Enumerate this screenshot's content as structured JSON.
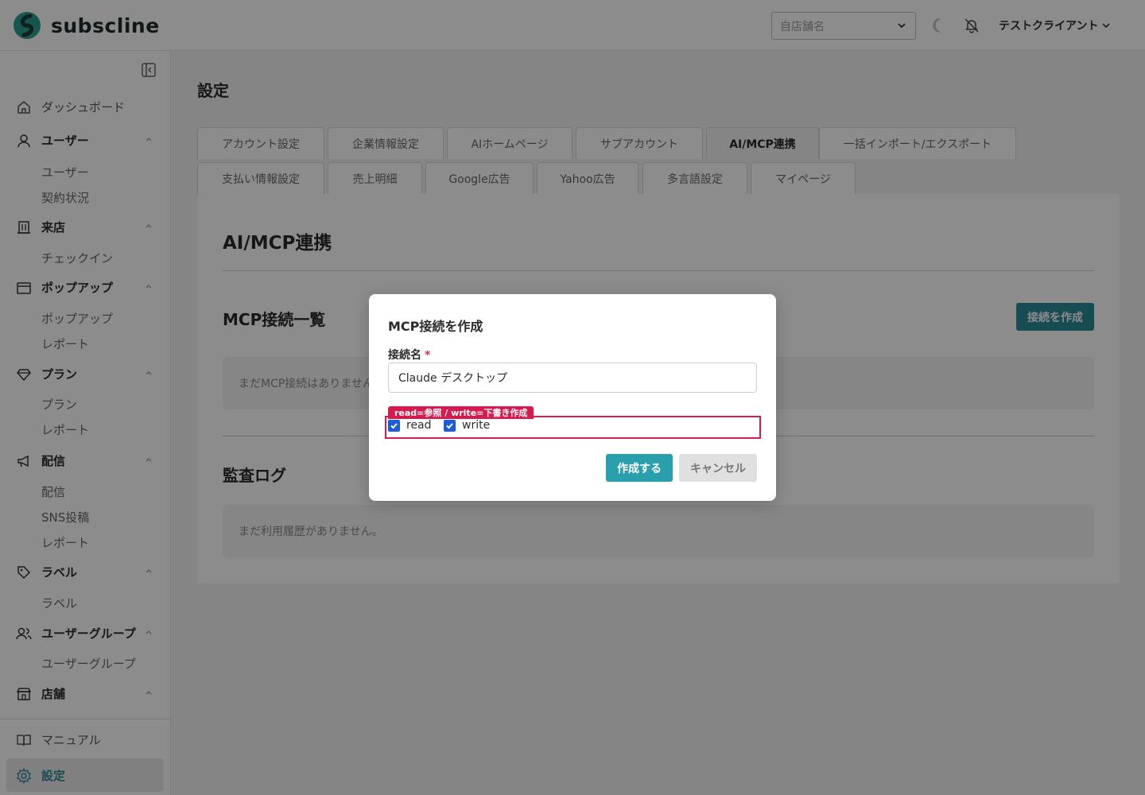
{
  "header": {
    "logo_text": "subscline",
    "store_select_placeholder": "自店舗名",
    "user_name": "テストクライアント"
  },
  "sidebar": {
    "items": {
      "dashboard": "ダッシュボード",
      "users": "ユーザー",
      "users_sub": [
        "ユーザー",
        "契約状況"
      ],
      "visit": "来店",
      "visit_sub": [
        "チェックイン"
      ],
      "popup": "ポップアップ",
      "popup_sub": [
        "ポップアップ",
        "レポート"
      ],
      "plan": "プラン",
      "plan_sub": [
        "プラン",
        "レポート"
      ],
      "delivery": "配信",
      "delivery_sub": [
        "配信",
        "SNS投稿",
        "レポート"
      ],
      "label": "ラベル",
      "label_sub": [
        "ラベル"
      ],
      "usergroup": "ユーザーグループ",
      "usergroup_sub": [
        "ユーザーグループ"
      ],
      "store": "店舗",
      "manual": "マニュアル",
      "settings": "設定"
    }
  },
  "main": {
    "page_title": "設定",
    "tabs_row1": [
      "アカウント設定",
      "企業情報設定",
      "AIホームページ",
      "サブアカウント",
      "AI/MCP連携",
      "一括インポート/エクスポート"
    ],
    "tabs_row2": [
      "支払い情報設定",
      "売上明細",
      "Google広告",
      "Yahoo広告",
      "多言語設定",
      "マイページ"
    ],
    "active_tab": "AI/MCP連携",
    "panel_title": "AI/MCP連携",
    "mcp_section_title": "MCP接続一覧",
    "create_connection_label": "接続を作成",
    "mcp_empty": "まだMCP接続はありません。",
    "audit_section_title": "監査ログ",
    "audit_empty": "まだ利用履歴がありません。"
  },
  "modal": {
    "title": "MCP接続を作成",
    "name_label": "接続名",
    "required_mark": "*",
    "name_value": "Claude デスクトップ",
    "scope_hint": "read=参照 / write=下書き作成",
    "scopes": [
      {
        "label": "read",
        "checked": true
      },
      {
        "label": "write",
        "checked": true
      }
    ],
    "submit_label": "作成する",
    "cancel_label": "キャンセル"
  },
  "colors": {
    "brand_teal": "#2a8a95",
    "primary_button": "#2aa0ad",
    "highlight": "#d81b4f",
    "checkbox": "#1a5fd6"
  }
}
